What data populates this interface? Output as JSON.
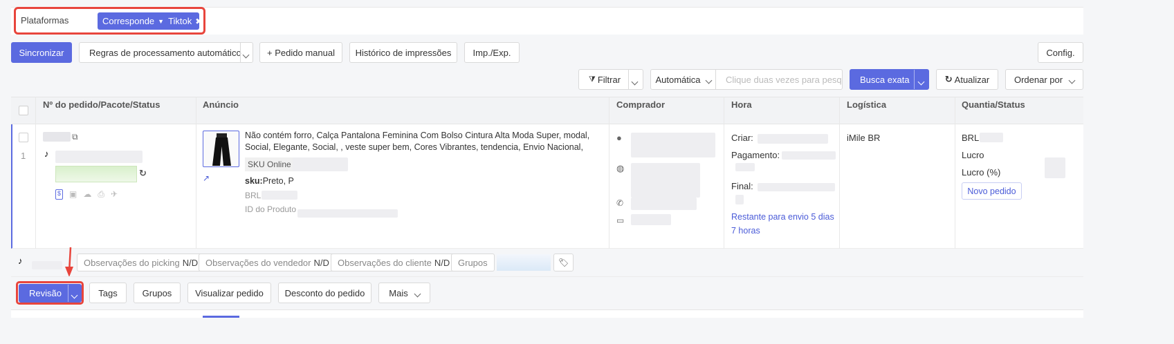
{
  "filter": {
    "label": "Plataformas",
    "chip_mode": "Corresponde",
    "chip_value": "Tiktok"
  },
  "toolbar": {
    "sync": "Sincronizar",
    "rules": "Regras de processamento automático",
    "manual_order": "+ Pedido manual",
    "print_history": "Histórico de impressões",
    "imp_exp": "Imp./Exp.",
    "config": "Config."
  },
  "search": {
    "filter": "Filtrar",
    "mode": "Automática",
    "placeholder": "Clique duas vezes para pesq",
    "exact": "Busca exata",
    "refresh": "Atualizar",
    "sort": "Ordenar por"
  },
  "table": {
    "columns": [
      "Nº do pedido/Pacote/Status",
      "Anúncio",
      "Comprador",
      "Hora",
      "Logística",
      "Quantia/Status"
    ]
  },
  "order": {
    "index": "1",
    "title": "Não contém forro, Calça Pantalona Feminina Com Bolso Cintura Alta Moda Super, modal, Social, Elegante, Social, , veste super bem, Cores Vibrantes, tendencia, Envio Nacional,",
    "sku_online": "SKU Online",
    "sku_label": "sku:",
    "sku_value": "Preto, P",
    "price_prefix": "BRL",
    "product_id_label": "ID do Produto",
    "time_created": "Criar:",
    "time_payment": "Pagamento:",
    "time_final": "Final:",
    "time_remaining": "Restante para envio 5 dias 7 horas",
    "logistics": "iMile BR",
    "amount_prefix": "BRL",
    "profit": "Lucro",
    "profit_pct": "Lucro (%)",
    "new_order": "Novo pedido"
  },
  "notes": {
    "picking": "Observações do picking",
    "seller": "Observações do vendedor",
    "customer": "Observações do cliente",
    "na": "N/D",
    "groups": "Grupos"
  },
  "actions": {
    "review": "Revisão",
    "tags": "Tags",
    "groups": "Grupos",
    "view": "Visualizar pedido",
    "discount": "Desconto do pedido",
    "more": "Mais"
  },
  "colors": {
    "primary": "#5b6ae0",
    "highlight": "#e8453c",
    "link": "#4a5bd8"
  }
}
